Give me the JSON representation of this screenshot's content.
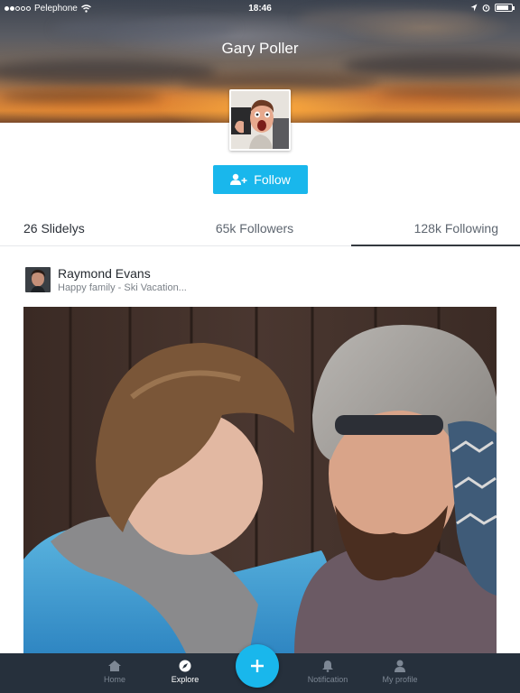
{
  "status_bar": {
    "carrier": "Pelephone",
    "time": "18:46",
    "signal_icon": "signal-dots-icon",
    "wifi_icon": "wifi-icon",
    "location_icon": "location-arrow-icon",
    "alarm_icon": "alarm-icon",
    "battery_icon": "battery-icon",
    "battery_level": 0.8
  },
  "profile": {
    "name": "Gary Poller",
    "cover_icon": "sunset-cover-image",
    "avatar_icon": "profile-avatar-image"
  },
  "follow_button": {
    "label": "Follow",
    "icon": "add-user-icon",
    "color": "#19b7ec"
  },
  "stats": {
    "slidelys": "26 Slidelys",
    "followers": "65k Followers",
    "following": "128k Following",
    "active_tab": "following"
  },
  "post": {
    "author": "Raymond Evans",
    "caption": "Happy family - Ski Vacation...",
    "author_avatar": "author-avatar-image",
    "photo": "family-photo-image"
  },
  "bottom_nav": {
    "items": [
      {
        "label": "Home",
        "icon": "home-icon",
        "active": false
      },
      {
        "label": "Explore",
        "icon": "compass-icon",
        "active": true
      },
      {
        "label": "Notification",
        "icon": "bell-icon",
        "active": false
      },
      {
        "label": "My profile",
        "icon": "person-icon",
        "active": false
      }
    ],
    "fab_icon": "plus-icon",
    "background": "#26303c",
    "accent": "#19b7ec"
  }
}
